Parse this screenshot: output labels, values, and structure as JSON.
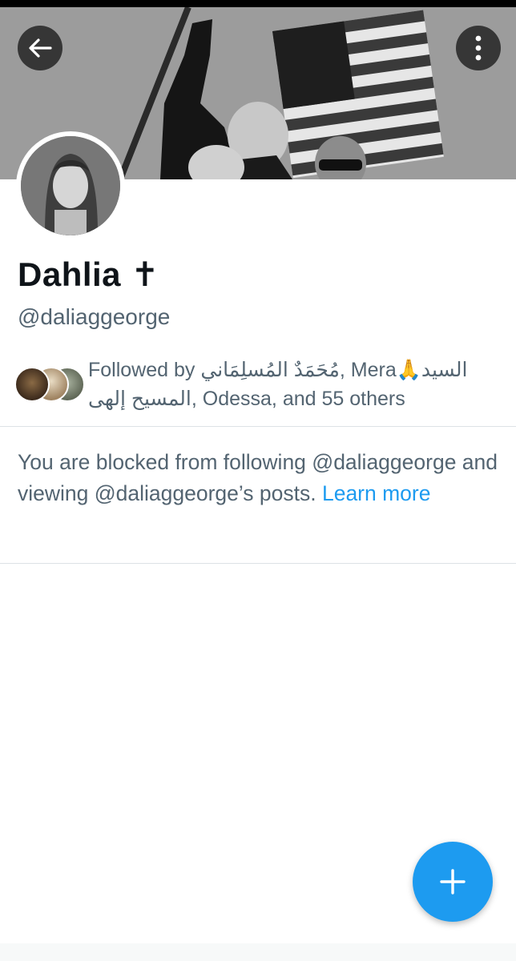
{
  "profile": {
    "display_name": "Dahlia ✝",
    "handle": "@daliaggeorge"
  },
  "followers": {
    "followed_by_text": "Followed by مُحَمَدٌ المُسلِمَاني, Mera🙏السيد المسيح إلهى, Odessa, and 55 others"
  },
  "blocked": {
    "message": "You are blocked from following @daliaggeorge and viewing @daliaggeorge’s posts. ",
    "learn_more": "Learn more"
  },
  "icons": {
    "back": "arrow-left-icon",
    "more": "more-vertical-icon",
    "compose": "plus-icon"
  },
  "colors": {
    "accent": "#1d9bf0",
    "secondary_text": "#536471",
    "primary_text": "#0f1419",
    "divider": "#dde2e6"
  }
}
